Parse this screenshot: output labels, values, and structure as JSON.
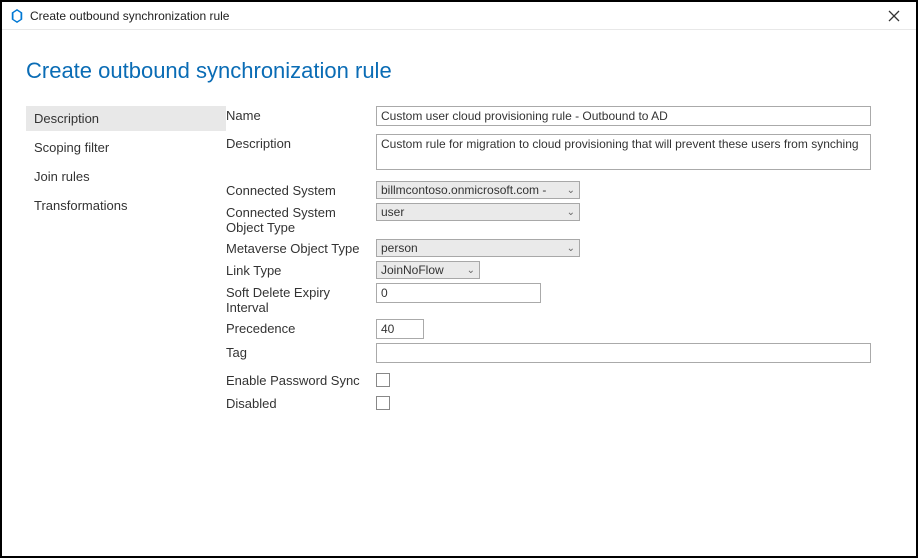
{
  "titlebar": {
    "title": "Create outbound synchronization rule"
  },
  "heading": "Create outbound synchronization rule",
  "sidebar": {
    "items": [
      {
        "label": "Description"
      },
      {
        "label": "Scoping filter"
      },
      {
        "label": "Join rules"
      },
      {
        "label": "Transformations"
      }
    ]
  },
  "form": {
    "name_label": "Name",
    "name_value": "Custom user cloud provisioning rule - Outbound to AD",
    "description_label": "Description",
    "description_value": "Custom rule for migration to cloud provisioning that will prevent these users from synching",
    "connected_system_label": "Connected System",
    "connected_system_value": "billmcontoso.onmicrosoft.com - ",
    "connected_system_object_type_label": "Connected System Object Type",
    "connected_system_object_type_value": "user",
    "metaverse_object_type_label": "Metaverse Object Type",
    "metaverse_object_type_value": "person",
    "link_type_label": "Link Type",
    "link_type_value": "JoinNoFlow",
    "soft_delete_label": "Soft Delete Expiry Interval",
    "soft_delete_value": "0",
    "precedence_label": "Precedence",
    "precedence_value": "40",
    "tag_label": "Tag",
    "tag_value": "",
    "enable_password_sync_label": "Enable Password Sync",
    "disabled_label": "Disabled"
  }
}
